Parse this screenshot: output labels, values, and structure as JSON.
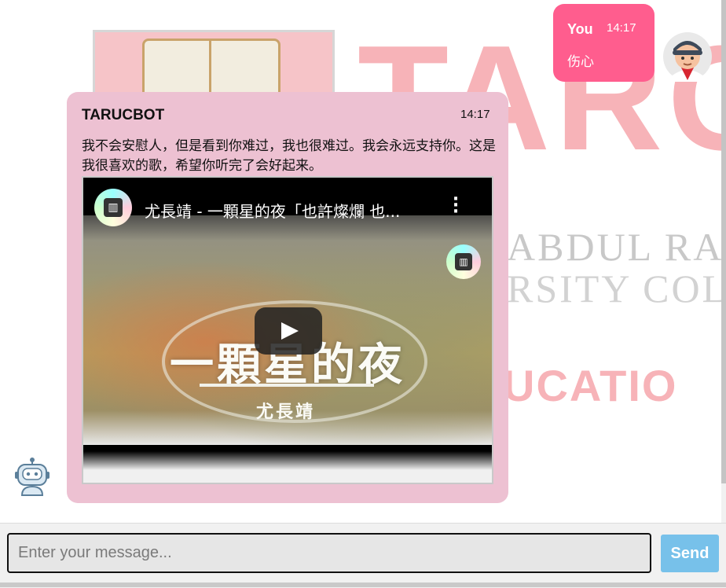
{
  "background": {
    "watermark_letters": "TARC",
    "watermark_line1": "ABDUL RAHM",
    "watermark_line2": "RSITY COLL",
    "watermark_line3": "UCATIO"
  },
  "messages": [
    {
      "sender": "You",
      "time": "14:17",
      "text": "伤心",
      "bubble_color": "#ff5d8e",
      "avatar_icon": "user-avatar-icon"
    },
    {
      "sender": "TARUCBOT",
      "time": "14:17",
      "text": "我不会安慰人，但是看到你难过，我也很难过。我会永远支持你。这是我很喜欢的歌，希望你听完了会好起来。",
      "bubble_color": "#edc1d2",
      "avatar_icon": "bot-avatar-icon",
      "video": {
        "title": "尤長靖 - 一顆星的夜「也許燦爛 也...",
        "thumbnail_title": "一顆星的夜",
        "thumbnail_artist": "尤長靖",
        "play_icon": "play-icon",
        "menu_icon": "more-vertical-icon",
        "channel_icon": "channel-logo-icon"
      }
    }
  ],
  "composer": {
    "placeholder": "Enter your message...",
    "send_label": "Send",
    "send_color": "#77c1ea"
  }
}
